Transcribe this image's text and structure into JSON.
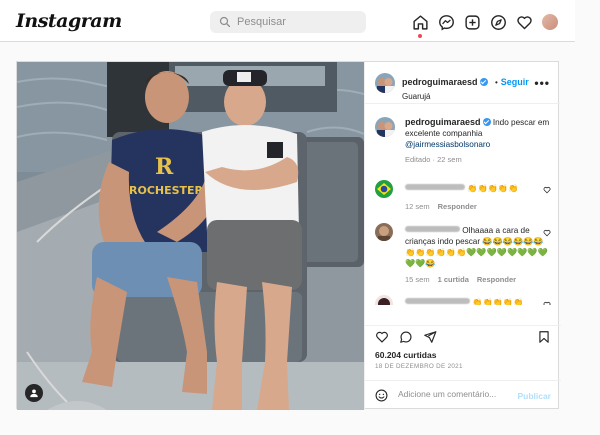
{
  "app": {
    "logo_text": "Instagram"
  },
  "search": {
    "placeholder": "Pesquisar"
  },
  "nav": {
    "icons": [
      "home-icon",
      "messenger-icon",
      "new-post-icon",
      "explore-icon",
      "activity-heart-icon",
      "profile-avatar"
    ]
  },
  "post": {
    "author": {
      "username": "pedroguimaraesd",
      "verified": true,
      "follow_separator": "•",
      "follow_label": "Seguir",
      "location": "Guarujá",
      "more_label": "•••"
    },
    "caption": {
      "username": "pedroguimaraesd",
      "text": "Indo pescar em excelente companhia",
      "mention": "@jairmessiasbolsonaro",
      "edited_label": "Editado",
      "time": "22 sem"
    },
    "comments": [
      {
        "text": "👏👏👏👏👏",
        "time": "12 sem",
        "reply_label": "Responder"
      },
      {
        "text": "Olhaaaa a cara de crianças indo pescar 😂😂😂😂😂😂 👏👏👏👏👏👏💚💚💚💚💚💚💚💚💚💚😂",
        "time": "15 sem",
        "likes_label": "1 curtida",
        "reply_label": "Responder"
      },
      {
        "text": "👏👏👏👏👏"
      }
    ],
    "likes": "60.204 curtidas",
    "date": "18 DE DEZEMBRO DE 2021",
    "add_comment_placeholder": "Adicione um comentário...",
    "publish_label": "Publicar"
  },
  "colors": {
    "accent": "#0095f6",
    "publish_disabled": "#b2dffc",
    "notification_dot": "#ed4956",
    "border": "#dbdbdb"
  }
}
